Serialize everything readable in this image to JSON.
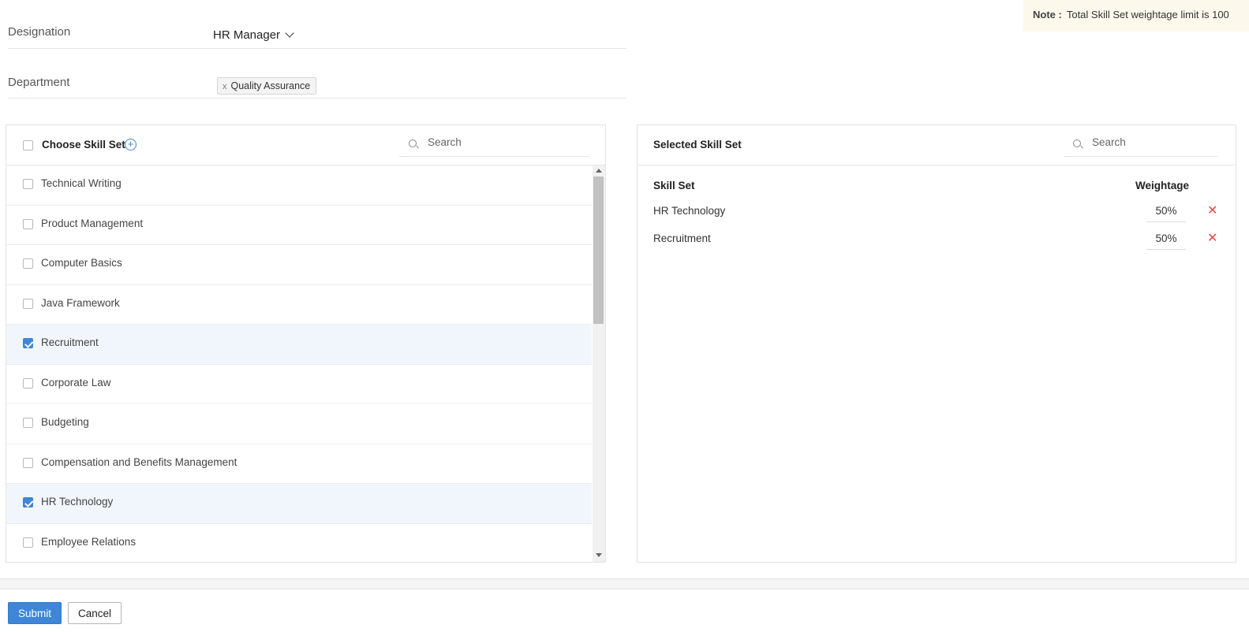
{
  "note": {
    "label": "Note :",
    "text": "Total Skill Set weightage limit is 100"
  },
  "form": {
    "designation": {
      "label": "Designation",
      "value": "HR Manager"
    },
    "department": {
      "label": "Department",
      "tag_remove": "x",
      "tag": "Quality Assurance"
    }
  },
  "choose_panel": {
    "title": "Choose Skill Set",
    "add_icon": "plus-circle-icon",
    "search_placeholder": "Search",
    "items": [
      {
        "label": "Technical Writing",
        "checked": false
      },
      {
        "label": "Product Management",
        "checked": false
      },
      {
        "label": "Computer Basics",
        "checked": false
      },
      {
        "label": "Java Framework",
        "checked": false
      },
      {
        "label": "Recruitment",
        "checked": true
      },
      {
        "label": "Corporate Law",
        "checked": false
      },
      {
        "label": "Budgeting",
        "checked": false
      },
      {
        "label": "Compensation and Benefits Management",
        "checked": false
      },
      {
        "label": "HR Technology",
        "checked": true
      },
      {
        "label": "Employee Relations",
        "checked": false
      }
    ]
  },
  "selected_panel": {
    "title": "Selected Skill Set",
    "search_placeholder": "Search",
    "col_skill": "Skill Set",
    "col_weightage": "Weightage",
    "rows": [
      {
        "name": "HR Technology",
        "weightage": "50%"
      },
      {
        "name": "Recruitment",
        "weightage": "50%"
      }
    ],
    "remove_glyph": "✕"
  },
  "footer": {
    "submit_label": "Submit",
    "cancel_label": "Cancel"
  },
  "colors": {
    "accent": "#3e86d7",
    "selected_row": "#f1f6fc",
    "remove": "#e04b4b",
    "note_bg": "#fdf8ec"
  }
}
